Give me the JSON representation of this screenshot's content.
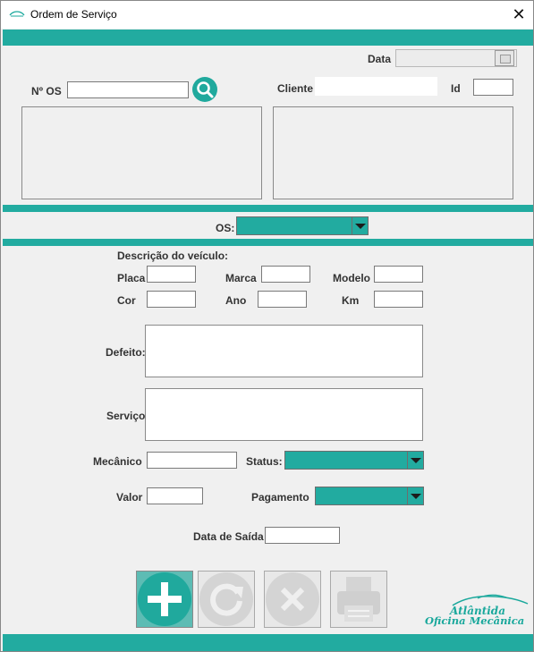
{
  "window": {
    "title": "Ordem de Serviço",
    "close_label": "✕"
  },
  "top": {
    "data_label": "Data",
    "data_value": "",
    "nos_label": "Nº OS",
    "nos_value": "",
    "cliente_label": "Cliente",
    "cliente_value": "",
    "id_label": "Id",
    "id_value": ""
  },
  "os_selector": {
    "label": "OS:",
    "value": ""
  },
  "vehicle": {
    "section_label": "Descrição do veículo:",
    "placa_label": "Placa",
    "marca_label": "Marca",
    "modelo_label": "Modelo",
    "cor_label": "Cor",
    "ano_label": "Ano",
    "km_label": "Km"
  },
  "order": {
    "defeito_label": "Defeito:",
    "servico_label": "Serviço",
    "mecanico_label": "Mecânico",
    "status_label": "Status:",
    "valor_label": "Valor",
    "pagamento_label": "Pagamento",
    "data_saida_label": "Data de Saída"
  },
  "actions": [
    "add",
    "refresh",
    "delete",
    "print"
  ],
  "logo": {
    "line1": "Atlântida",
    "line2": "Oficina Mecânica"
  },
  "colors": {
    "accent": "#22aba0",
    "background": "#f0f0f0"
  }
}
